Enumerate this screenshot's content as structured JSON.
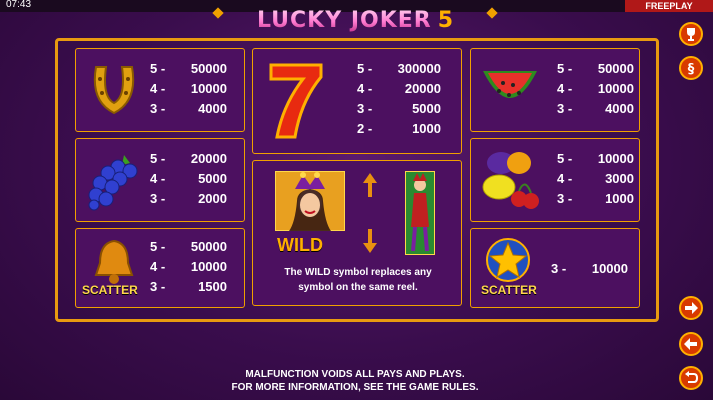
{
  "status_bar": {
    "time": "07:43",
    "mode": "FREEPLAY"
  },
  "logo": {
    "text": "LUCKY JOKER",
    "number": "5"
  },
  "symbols": {
    "horseshoe": {
      "icon": "horseshoe-icon",
      "pays": [
        {
          "count": "5 -",
          "value": "50000"
        },
        {
          "count": "4 -",
          "value": "10000"
        },
        {
          "count": "3 -",
          "value": "4000"
        }
      ]
    },
    "seven": {
      "icon": "seven-icon",
      "pays": [
        {
          "count": "5 -",
          "value": "300000"
        },
        {
          "count": "4 -",
          "value": "20000"
        },
        {
          "count": "3 -",
          "value": "5000"
        },
        {
          "count": "2 -",
          "value": "1000"
        }
      ]
    },
    "watermelon": {
      "icon": "watermelon-icon",
      "pays": [
        {
          "count": "5 -",
          "value": "50000"
        },
        {
          "count": "4 -",
          "value": "10000"
        },
        {
          "count": "3 -",
          "value": "4000"
        }
      ]
    },
    "grapes": {
      "icon": "grapes-icon",
      "pays": [
        {
          "count": "5 -",
          "value": "20000"
        },
        {
          "count": "4 -",
          "value": "5000"
        },
        {
          "count": "3 -",
          "value": "2000"
        }
      ]
    },
    "fruits": {
      "icon": "fruit-mix-icon",
      "pays": [
        {
          "count": "5 -",
          "value": "10000"
        },
        {
          "count": "4 -",
          "value": "3000"
        },
        {
          "count": "3 -",
          "value": "1000"
        }
      ]
    },
    "bell": {
      "icon": "bell-icon",
      "label": "SCATTER",
      "pays": [
        {
          "count": "5 -",
          "value": "50000"
        },
        {
          "count": "4 -",
          "value": "10000"
        },
        {
          "count": "3 -",
          "value": "1500"
        }
      ]
    },
    "star": {
      "icon": "star-icon",
      "label": "SCATTER",
      "pays": [
        {
          "count": "3 -",
          "value": "10000"
        }
      ]
    }
  },
  "wild": {
    "label": "WILD",
    "description_line1": "The WILD symbol replaces any",
    "description_line2": "symbol on the same reel."
  },
  "footer": {
    "line1": "MALFUNCTION VOIDS ALL PAYS AND PLAYS.",
    "line2": "FOR MORE INFORMATION, SEE THE GAME RULES."
  },
  "side_buttons": [
    "trophy-icon",
    "paragraph-icon",
    "arrow-right-icon",
    "arrow-left-icon",
    "return-icon"
  ],
  "colors": {
    "accent": "#f0a000",
    "panel": "#4c1060",
    "button": "#d83a00",
    "mode_badge": "#b01818"
  }
}
